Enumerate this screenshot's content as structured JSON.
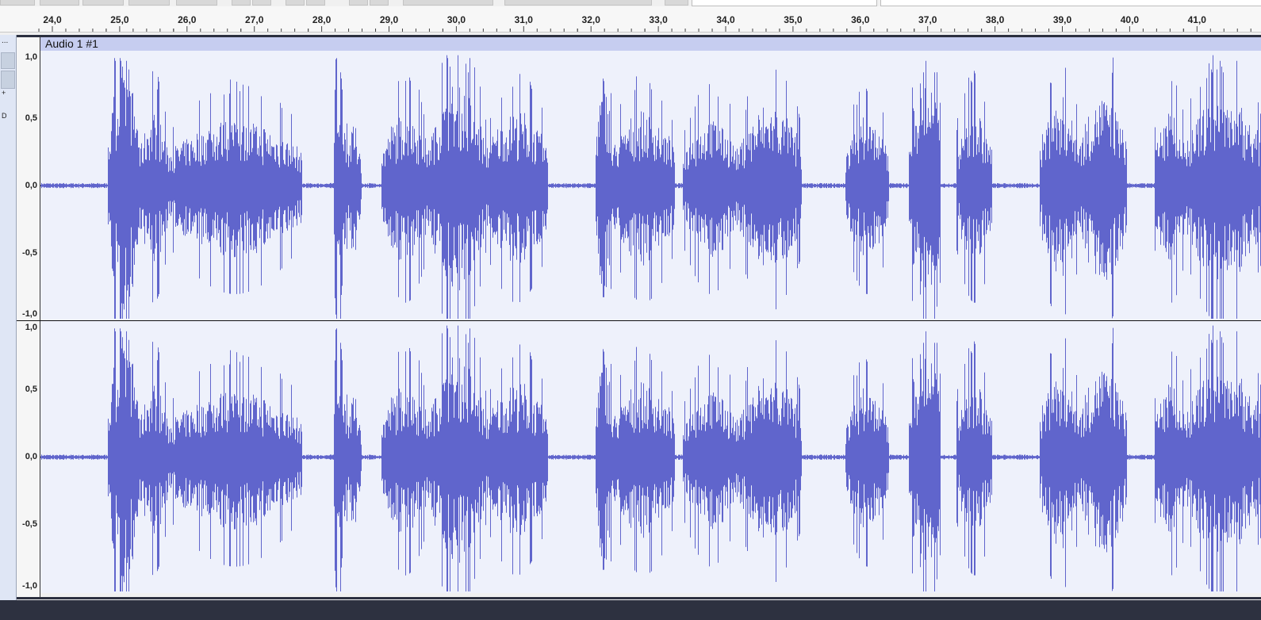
{
  "track": {
    "title": "Audio 1 #1",
    "color": "#6065cc",
    "ctrl": {
      "plus": "+",
      "d": "D",
      "menu": "..."
    }
  },
  "ruler": {
    "labels": [
      "24,0",
      "25,0",
      "26,0",
      "27,0",
      "28,0",
      "29,0",
      "30,0",
      "31,0",
      "32,0",
      "33,0",
      "34,0",
      "35,0",
      "36,0",
      "37,0",
      "38,0",
      "39,0",
      "40,0",
      "41,0"
    ]
  },
  "channels": [
    {
      "scale": [
        "1,0",
        "0,5",
        "0,0",
        "-0,5",
        "-1,0"
      ]
    },
    {
      "scale": [
        "1,0",
        "0,5",
        "0,0",
        "-0,5",
        "-1,0"
      ]
    }
  ]
}
